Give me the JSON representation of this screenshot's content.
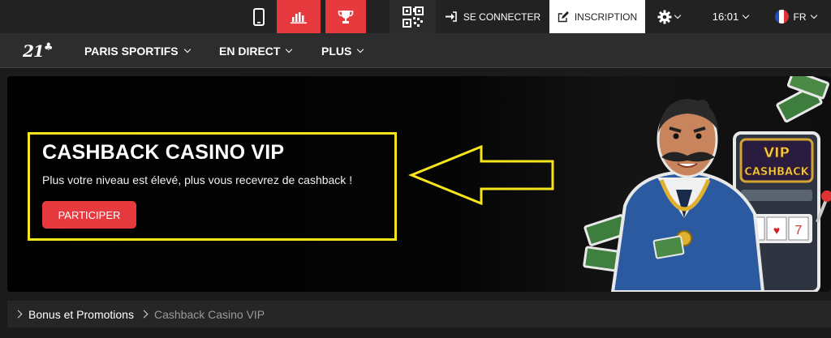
{
  "topbar": {
    "login_label": "SE CONNECTER",
    "signup_label": "INSCRIPTION",
    "time": "16:01",
    "language": "FR"
  },
  "nav": {
    "logo_text": "21",
    "items": [
      {
        "label": "PARIS SPORTIFS"
      },
      {
        "label": "EN DIRECT"
      },
      {
        "label": "PLUS"
      }
    ]
  },
  "promo": {
    "title": "CASHBACK CASINO VIP",
    "subtitle": "Plus votre niveau est élevé, plus vous recevrez de cashback !",
    "cta_label": "PARTICIPER",
    "art_sign_line1": "VIP",
    "art_sign_line2": "CASHBACK"
  },
  "breadcrumb": {
    "items": [
      "Bonus et Promotions",
      "Cashback Casino VIP"
    ]
  },
  "colors": {
    "accent": "#e63a3f",
    "highlight": "#f5e51a",
    "topbar_bg": "#222222",
    "navbar_bg": "#2d2d2d"
  },
  "icons": [
    "phone-icon",
    "stats-icon",
    "trophy-icon",
    "qr-code-icon",
    "login-icon",
    "edit-icon",
    "gear-icon",
    "chevron-down-icon",
    "french-flag-icon",
    "chevron-right-icon"
  ]
}
